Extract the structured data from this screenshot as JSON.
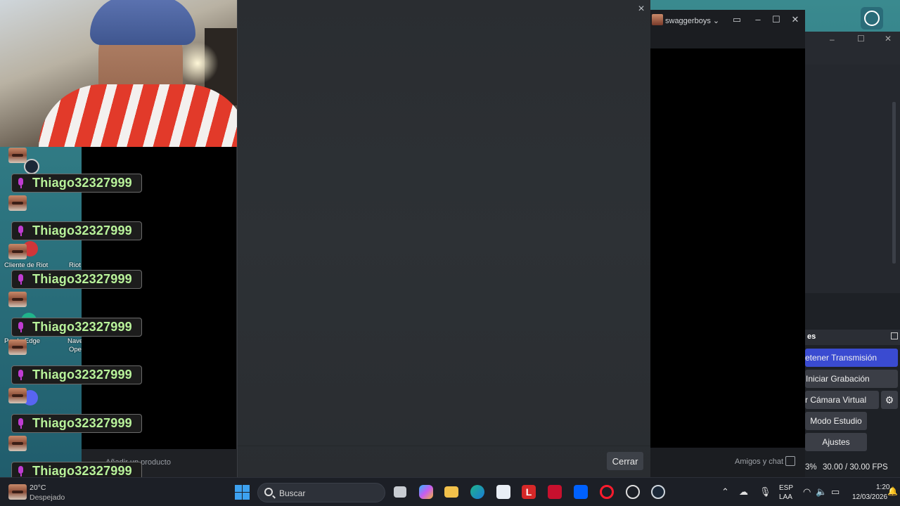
{
  "overlay": {
    "close_button": "×",
    "cerrar_label": "Cerrar"
  },
  "chat": {
    "entries": [
      {
        "name": "Thiago32327999"
      },
      {
        "name": "Thiago32327999"
      },
      {
        "name": "Thiago32327999"
      },
      {
        "name": "Thiago32327999"
      },
      {
        "name": "Thiago32327999"
      },
      {
        "name": "Thiago32327999"
      },
      {
        "name": "Thiago32327999"
      }
    ],
    "name_color": "#b8f29a",
    "mic_color": "#c03cd2"
  },
  "desktop": {
    "icon_labels": [
      "Cliente de Riot",
      "Riot",
      "P...al - Edge",
      "Nave",
      "Ope"
    ],
    "bottom_item": "Añadir un producto"
  },
  "steam_friends": {
    "username": "swaggerboys",
    "dropdown": "⌄",
    "footer_label": "Amigos y chat"
  },
  "obs": {
    "panel_title": "es",
    "buttons": {
      "stop_stream": "etener Transmisión",
      "start_record": "Iniciar Grabación",
      "virtual_cam": "r Cámara Virtual",
      "studio_mode": "Modo Estudio",
      "settings": "Ajustes"
    },
    "status": {
      "cpu": "3%",
      "fps": "30.00 / 30.00 FPS"
    },
    "accent": "#3a4bd1"
  },
  "taskbar": {
    "weather_temp": "20°C",
    "weather_cond": "Despejado",
    "search_placeholder": "Buscar",
    "lang_top": "ESP",
    "lang_bottom": "LAA",
    "time": "1:20",
    "date": "12/03/2026"
  }
}
